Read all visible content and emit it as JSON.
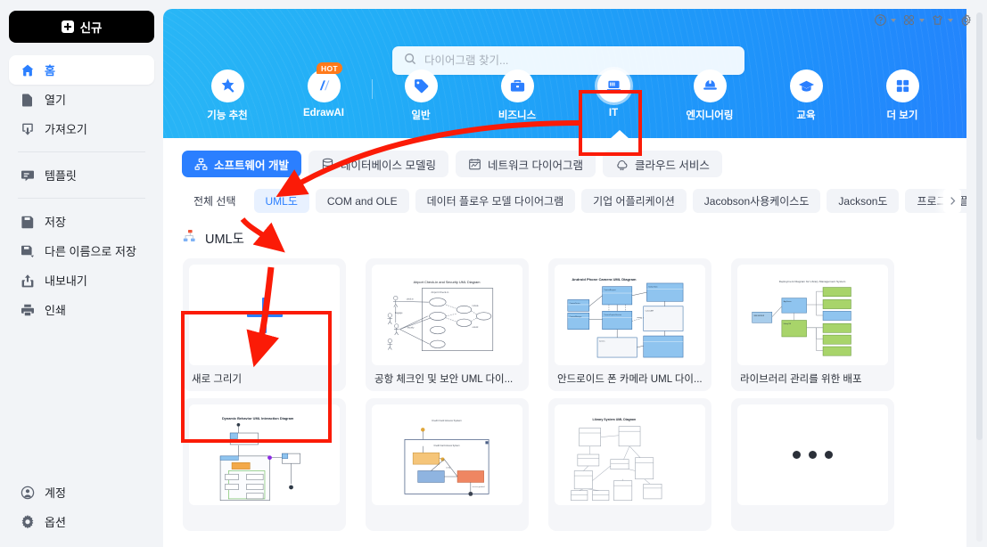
{
  "sidebar": {
    "new_button": {
      "label": "신규",
      "icon": "plus-icon"
    },
    "items": [
      {
        "label": "홈",
        "icon": "home-icon",
        "active": true
      },
      {
        "label": "열기",
        "icon": "open-file-icon",
        "active": false
      },
      {
        "label": "가져오기",
        "icon": "import-icon",
        "active": false
      },
      {
        "label": "템플릿",
        "icon": "template-icon",
        "active": false
      },
      {
        "label": "저장",
        "icon": "save-icon",
        "active": false
      },
      {
        "label": "다른 이름으로 저장",
        "icon": "save-as-icon",
        "active": false
      },
      {
        "label": "내보내기",
        "icon": "export-icon",
        "active": false
      },
      {
        "label": "인쇄",
        "icon": "print-icon",
        "active": false
      }
    ],
    "bottom_items": [
      {
        "label": "계정",
        "icon": "account-icon"
      },
      {
        "label": "옵션",
        "icon": "settings-icon"
      }
    ]
  },
  "titlebar": {
    "icons": [
      {
        "name": "help-icon",
        "has_caret": true
      },
      {
        "name": "apps-grid-icon",
        "has_caret": true
      },
      {
        "name": "theme-shirt-icon",
        "has_caret": true
      },
      {
        "name": "gear-icon",
        "has_caret": false
      }
    ]
  },
  "search": {
    "placeholder": "다이어그램 찾기...",
    "value": "",
    "icon": "search-icon"
  },
  "banner": {
    "categories": [
      {
        "label": "기능 추천",
        "icon": "feature-star-icon",
        "badge": "",
        "selected": false
      },
      {
        "label": "EdrawAI",
        "icon": "edraw-ai-icon",
        "badge": "HOT",
        "selected": false
      },
      {
        "label": "일반",
        "icon": "general-tag-icon",
        "badge": "",
        "selected": false
      },
      {
        "label": "비즈니스",
        "icon": "business-case-icon",
        "badge": "",
        "selected": false
      },
      {
        "label": "IT",
        "icon": "it-laptop-icon",
        "badge": "",
        "selected": true
      },
      {
        "label": "엔지니어링",
        "icon": "engineering-helmet-icon",
        "badge": "",
        "selected": false
      },
      {
        "label": "교육",
        "icon": "education-cap-icon",
        "badge": "",
        "selected": false
      },
      {
        "label": "더 보기",
        "icon": "more-grid-icon",
        "badge": "",
        "selected": false
      }
    ]
  },
  "tabs": [
    {
      "label": "소프트웨어 개발",
      "icon": "software-dev-icon",
      "active": true
    },
    {
      "label": "데이터베이스 모델링",
      "icon": "database-icon",
      "active": false
    },
    {
      "label": "네트워크 다이어그램",
      "icon": "network-icon",
      "active": false
    },
    {
      "label": "클라우드 서비스",
      "icon": "cloud-icon",
      "active": false
    }
  ],
  "filters": {
    "items": [
      {
        "label": "전체 선택",
        "style": "plain",
        "selected": false
      },
      {
        "label": "UML도",
        "style": "chip",
        "selected": true
      },
      {
        "label": "COM and OLE",
        "style": "chip",
        "selected": false
      },
      {
        "label": "데이터 플로우 모델 다이어그램",
        "style": "chip",
        "selected": false
      },
      {
        "label": "기업 어플리케이션",
        "style": "chip",
        "selected": false
      },
      {
        "label": "Jacobson사용케이스도",
        "style": "chip",
        "selected": false
      },
      {
        "label": "Jackson도",
        "style": "chip",
        "selected": false
      },
      {
        "label": "프로그램 플로우차트",
        "style": "chip",
        "selected": false
      }
    ],
    "scroll_next_icon": "chevron-right-icon"
  },
  "section": {
    "title": "UML도",
    "icon": "uml-tree-icon"
  },
  "cards": [
    {
      "label": "새로 그리기",
      "type": "new"
    },
    {
      "label": "공항 체크인 및 보안 UML 다이...",
      "type": "usecase",
      "thumb_title": "Airport Check-in and Security UML Diagram"
    },
    {
      "label": "안드로이드 폰 카메라 UML 다이...",
      "type": "class-blue",
      "thumb_title": "Android Phone Camera UML Diagram"
    },
    {
      "label": "라이브러리 관리를 위한 배포",
      "type": "deploy-green",
      "thumb_title": "Deployment Diagram for Library Management System"
    },
    {
      "label": "",
      "type": "sequence",
      "thumb_title": "Dynamic Behavior UML Interaction Diagram"
    },
    {
      "label": "",
      "type": "activity",
      "thumb_title": "Credit Card Access System"
    },
    {
      "label": "",
      "type": "class-plain",
      "thumb_title": "Library System UML Diagram"
    },
    {
      "label": "",
      "type": "more-dots"
    }
  ],
  "annotations": {
    "boxes": [
      {
        "name": "it-category-highlight"
      },
      {
        "name": "new-drawing-card-highlight"
      }
    ],
    "arrows": [
      {
        "name": "it-to-software-dev-arrow"
      },
      {
        "name": "software-dev-to-uml-arrow"
      },
      {
        "name": "uml-to-new-drawing-arrow"
      }
    ],
    "color": "#fb1b07"
  },
  "colors": {
    "accent": "#2b7fff",
    "annotation": "#fb1b07",
    "sidebar_bg": "#f2f4f7",
    "panel_bg": "#ffffff",
    "badge_hot": "#ff7a1a"
  },
  "scrollbar": {
    "name": "vertical-scrollbar"
  }
}
